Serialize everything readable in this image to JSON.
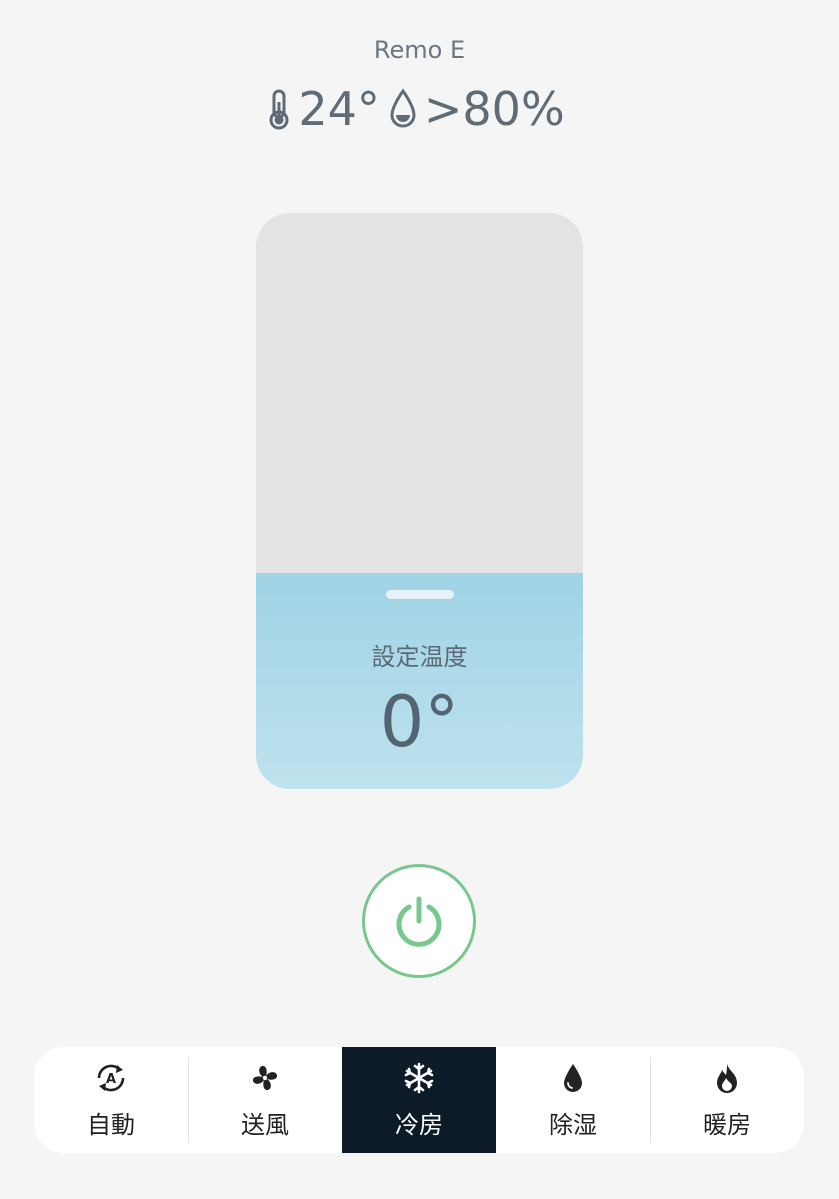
{
  "device": {
    "name": "Remo E"
  },
  "readings": {
    "temperature": "24°",
    "humidity": ">80%"
  },
  "thermostat": {
    "set_label": "設定温度",
    "set_temp": "0°",
    "level_fraction": 0.375
  },
  "power": {
    "state": "off",
    "color": "#78c88d"
  },
  "modes": [
    {
      "label": "自動",
      "icon": "auto-icon",
      "active": false
    },
    {
      "label": "送風",
      "icon": "fan-icon",
      "active": false
    },
    {
      "label": "冷房",
      "icon": "snowflake-icon",
      "active": true
    },
    {
      "label": "除湿",
      "icon": "droplet-icon",
      "active": false
    },
    {
      "label": "暖房",
      "icon": "flame-icon",
      "active": false
    }
  ],
  "colors": {
    "accent_active": "#0c1b27",
    "fill": "#9fd3e5",
    "text": "#5f6b75"
  }
}
